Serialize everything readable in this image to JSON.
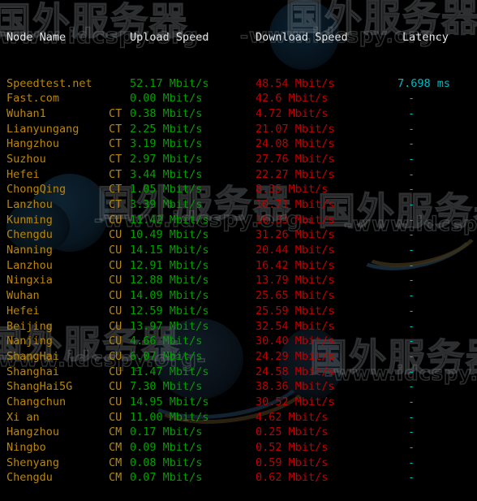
{
  "window": {
    "type": "terminal-speedtest-output",
    "background": "#000000"
  },
  "watermark": {
    "cn_text": "国外服务器",
    "url_text": "-www.idcspy.org-",
    "stroke_color": "#969ba0"
  },
  "colors": {
    "header": "#e6e6e6",
    "node": "#b8860b",
    "isp": "#b8860b",
    "upload": "#00a000",
    "download": "#c00000",
    "latency": "#00b8c0"
  },
  "table": {
    "headers": {
      "node": "Node Name",
      "isp": "",
      "upload": "Upload Speed",
      "download": "Download Speed",
      "latency": "Latency"
    },
    "rows": [
      {
        "node": "Speedtest.net",
        "isp": "",
        "upload": "52.17 Mbit/s",
        "download": "48.54 Mbit/s",
        "latency": "7.698 ms"
      },
      {
        "node": "Fast.com",
        "isp": "",
        "upload": "0.00 Mbit/s",
        "download": "42.6 Mbit/s",
        "latency": "-"
      },
      {
        "node": "Wuhan1",
        "isp": "CT",
        "upload": "0.38 Mbit/s",
        "download": "4.72 Mbit/s",
        "latency": "-"
      },
      {
        "node": "Lianyungang",
        "isp": "CT",
        "upload": "2.25 Mbit/s",
        "download": "21.07 Mbit/s",
        "latency": "-"
      },
      {
        "node": "Hangzhou",
        "isp": "CT",
        "upload": "3.19 Mbit/s",
        "download": "24.08 Mbit/s",
        "latency": "-"
      },
      {
        "node": "Suzhou",
        "isp": "CT",
        "upload": "2.97 Mbit/s",
        "download": "27.76 Mbit/s",
        "latency": "-"
      },
      {
        "node": "Hefei",
        "isp": "CT",
        "upload": "3.44 Mbit/s",
        "download": "22.27 Mbit/s",
        "latency": "-"
      },
      {
        "node": "ChongQing",
        "isp": "CT",
        "upload": "1.05 Mbit/s",
        "download": "8.35 Mbit/s",
        "latency": "-"
      },
      {
        "node": "Lanzhou",
        "isp": "CT",
        "upload": "3.39 Mbit/s",
        "download": "10.71 Mbit/s",
        "latency": "-"
      },
      {
        "node": "Kunming",
        "isp": "CU",
        "upload": "11.42 Mbit/s",
        "download": "16.33 Mbit/s",
        "latency": "-"
      },
      {
        "node": "Chengdu",
        "isp": "CU",
        "upload": "10.49 Mbit/s",
        "download": "31.26 Mbit/s",
        "latency": "-"
      },
      {
        "node": "Nanning",
        "isp": "CU",
        "upload": "14.15 Mbit/s",
        "download": "20.44 Mbit/s",
        "latency": "-"
      },
      {
        "node": "Lanzhou",
        "isp": "CU",
        "upload": "12.91 Mbit/s",
        "download": "16.42 Mbit/s",
        "latency": "-"
      },
      {
        "node": "Ningxia",
        "isp": "CU",
        "upload": "12.88 Mbit/s",
        "download": "13.79 Mbit/s",
        "latency": "-"
      },
      {
        "node": "Wuhan",
        "isp": "CU",
        "upload": "14.09 Mbit/s",
        "download": "25.65 Mbit/s",
        "latency": "-"
      },
      {
        "node": "Hefei",
        "isp": "CU",
        "upload": "12.59 Mbit/s",
        "download": "25.59 Mbit/s",
        "latency": "-"
      },
      {
        "node": "Beijing",
        "isp": "CU",
        "upload": "13.97 Mbit/s",
        "download": "32.54 Mbit/s",
        "latency": "-"
      },
      {
        "node": "Nanjing",
        "isp": "CU",
        "upload": "4.66 Mbit/s",
        "download": "30.40 Mbit/s",
        "latency": "-"
      },
      {
        "node": "ShangHai",
        "isp": "CU",
        "upload": "6.07 Mbit/s",
        "download": "24.29 Mbit/s",
        "latency": "-"
      },
      {
        "node": "Shanghai",
        "isp": "CU",
        "upload": "11.47 Mbit/s",
        "download": "24.58 Mbit/s",
        "latency": "-"
      },
      {
        "node": "ShangHai5G",
        "isp": "CU",
        "upload": "7.30 Mbit/s",
        "download": "38.36 Mbit/s",
        "latency": "-"
      },
      {
        "node": "Changchun",
        "isp": "CU",
        "upload": "14.95 Mbit/s",
        "download": "30.52 Mbit/s",
        "latency": "-"
      },
      {
        "node": "Xi an",
        "isp": "CU",
        "upload": "11.00 Mbit/s",
        "download": "4.62 Mbit/s",
        "latency": "-"
      },
      {
        "node": "Hangzhou",
        "isp": "CM",
        "upload": "0.17 Mbit/s",
        "download": "0.25 Mbit/s",
        "latency": "-"
      },
      {
        "node": "Ningbo",
        "isp": "CM",
        "upload": "0.09 Mbit/s",
        "download": "0.52 Mbit/s",
        "latency": "-"
      },
      {
        "node": "Shenyang",
        "isp": "CM",
        "upload": "0.08 Mbit/s",
        "download": "0.59 Mbit/s",
        "latency": "-"
      },
      {
        "node": "Chengdu",
        "isp": "CM",
        "upload": "0.07 Mbit/s",
        "download": "0.62 Mbit/s",
        "latency": "-"
      }
    ]
  }
}
